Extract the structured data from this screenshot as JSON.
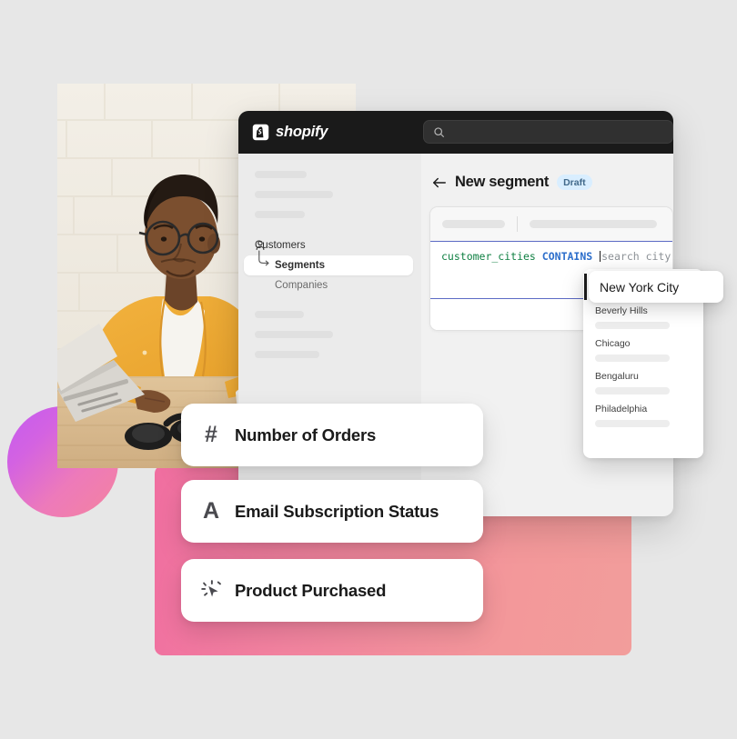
{
  "background_color": "#e7e7e7",
  "decor": {
    "circle": {
      "name": "gradient-circle",
      "from": "#c45cf0",
      "to": "#f4839f"
    },
    "pink_panel": {
      "name": "pink-panel",
      "from": "#f06ea0",
      "to": "#f29d9b"
    }
  },
  "photo": {
    "alt": "Person in yellow cardigan and glasses working on a laptop at a wooden desk with headphones and a white mug"
  },
  "admin": {
    "topbar": {
      "brand": "shopify",
      "brand_icon": "shopify-bag-icon",
      "search": {
        "icon": "search-icon",
        "value": "",
        "placeholder": ""
      }
    },
    "sidebar": {
      "skeleton_top": [
        "",
        "",
        ""
      ],
      "items": [
        {
          "label": "Customers",
          "icon": "person-icon",
          "state": "normal"
        },
        {
          "label": "Segments",
          "icon": "branch-arrow-icon",
          "state": "active"
        },
        {
          "label": "Companies",
          "icon": "",
          "state": "muted"
        }
      ],
      "skeleton_bottom": [
        "",
        "",
        ""
      ]
    },
    "main": {
      "back_icon": "back-arrow-icon",
      "title": "New segment",
      "status_badge": "Draft",
      "status_badge_bg": "#d9eeff",
      "status_badge_color": "#41698a",
      "editor": {
        "toolbar_pills": [
          "",
          ""
        ],
        "query": {
          "field": "customer_cities",
          "operator": "CONTAINS",
          "placeholder": "search city"
        },
        "field_color": "#108043",
        "operator_color": "#2c6ecb",
        "border_color": "#5c6ac4"
      }
    }
  },
  "city_dropdown": {
    "selected": "New York City",
    "options": [
      {
        "label": "Beverly Hills"
      },
      {
        "label": "Chicago"
      },
      {
        "label": "Bengaluru"
      },
      {
        "label": "Philadelphia"
      }
    ]
  },
  "attribute_cards": [
    {
      "label": "Number of Orders",
      "icon": "hash-icon",
      "glyph": "#"
    },
    {
      "label": "Email Subscription Status",
      "icon": "letter-a-icon",
      "glyph": "A"
    },
    {
      "label": "Product Purchased",
      "icon": "click-cursor-icon",
      "glyph": ""
    }
  ]
}
